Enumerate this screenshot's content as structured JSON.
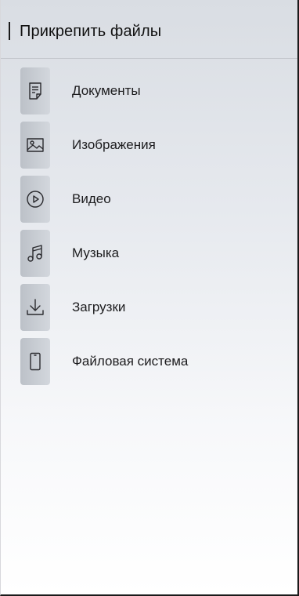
{
  "header": {
    "title": "Прикрепить файлы"
  },
  "items": [
    {
      "label": "Документы",
      "icon": "document-icon"
    },
    {
      "label": "Изображения",
      "icon": "image-icon"
    },
    {
      "label": "Видео",
      "icon": "play-icon"
    },
    {
      "label": "Музыка",
      "icon": "music-note-icon"
    },
    {
      "label": "Загрузки",
      "icon": "download-icon"
    },
    {
      "label": "Файловая система",
      "icon": "phone-icon"
    }
  ],
  "colors": {
    "tile": "#c9cdd3",
    "border": "#1a1a1a",
    "text": "#1c1c1e"
  }
}
